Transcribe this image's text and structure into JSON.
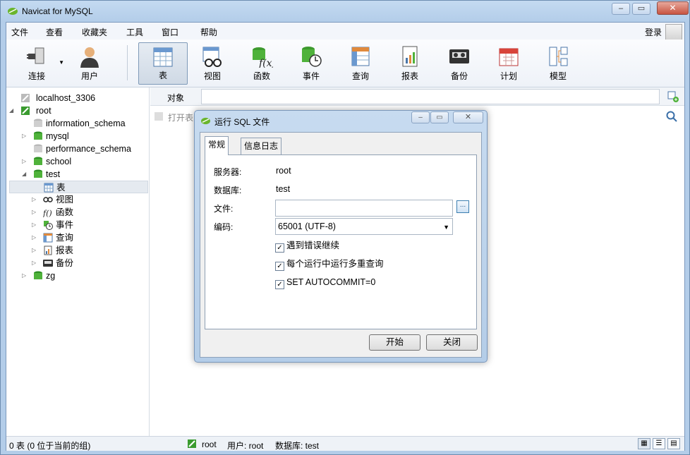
{
  "window": {
    "title": "Navicat for MySQL"
  },
  "menu": [
    "文件",
    "查看",
    "收藏夹",
    "工具",
    "窗口",
    "帮助"
  ],
  "login_label": "登录",
  "toolbar": [
    {
      "label": "连接",
      "icon": "connect-icon",
      "dropdown": true
    },
    {
      "label": "用户",
      "icon": "user-icon"
    },
    {
      "label": "表",
      "icon": "table-icon",
      "selected": true
    },
    {
      "label": "视图",
      "icon": "view-icon"
    },
    {
      "label": "函数",
      "icon": "function-icon"
    },
    {
      "label": "事件",
      "icon": "event-icon"
    },
    {
      "label": "查询",
      "icon": "query-icon"
    },
    {
      "label": "报表",
      "icon": "report-icon"
    },
    {
      "label": "备份",
      "icon": "backup-icon"
    },
    {
      "label": "计划",
      "icon": "schedule-icon"
    },
    {
      "label": "模型",
      "icon": "model-icon"
    }
  ],
  "tree": [
    {
      "label": "localhost_3306",
      "icon": "connection-icon",
      "level": 0,
      "arrow": ""
    },
    {
      "label": "root",
      "icon": "connection-open-icon",
      "level": 0,
      "arrow": "◢"
    },
    {
      "label": "information_schema",
      "icon": "database-gray-icon",
      "level": 1,
      "arrow": ""
    },
    {
      "label": "mysql",
      "icon": "database-icon",
      "level": 1,
      "arrow": "▷"
    },
    {
      "label": "performance_schema",
      "icon": "database-gray-icon",
      "level": 1,
      "arrow": ""
    },
    {
      "label": "school",
      "icon": "database-icon",
      "level": 1,
      "arrow": "▷"
    },
    {
      "label": "test",
      "icon": "database-icon",
      "level": 1,
      "arrow": "◢"
    },
    {
      "label": "表",
      "icon": "table-icon",
      "level": 2,
      "arrow": "",
      "selected": true
    },
    {
      "label": "视图",
      "icon": "view-icon",
      "level": 2,
      "arrow": "▷"
    },
    {
      "label": "函数",
      "icon": "function-icon",
      "level": 2,
      "arrow": "▷"
    },
    {
      "label": "事件",
      "icon": "event-icon",
      "level": 2,
      "arrow": "▷"
    },
    {
      "label": "查询",
      "icon": "query-icon",
      "level": 2,
      "arrow": "▷"
    },
    {
      "label": "报表",
      "icon": "report-icon",
      "level": 2,
      "arrow": "▷"
    },
    {
      "label": "备份",
      "icon": "backup-icon",
      "level": 2,
      "arrow": "▷"
    },
    {
      "label": "zg",
      "icon": "database-icon",
      "level": 1,
      "arrow": "▷"
    }
  ],
  "objects": {
    "label": "对象",
    "open_table": "打开表"
  },
  "status": {
    "left": "0 表 (0 位于当前的组)",
    "connection": "root",
    "user": "用户: root",
    "database": "数据库: test"
  },
  "dialog": {
    "title": "运行 SQL 文件",
    "tabs": [
      "常规",
      "信息日志"
    ],
    "server_label": "服务器:",
    "server": "root",
    "database_label": "数据库:",
    "database": "test",
    "file_label": "文件:",
    "file": "",
    "browse": "...",
    "encoding_label": "编码:",
    "encoding": "65001 (UTF-8)",
    "checkboxes": [
      {
        "label": "遇到错误继续",
        "checked": true
      },
      {
        "label": "每个运行中运行多重查询",
        "checked": true
      },
      {
        "label": "SET AUTOCOMMIT=0",
        "checked": true
      }
    ],
    "start": "开始",
    "close": "关闭"
  }
}
